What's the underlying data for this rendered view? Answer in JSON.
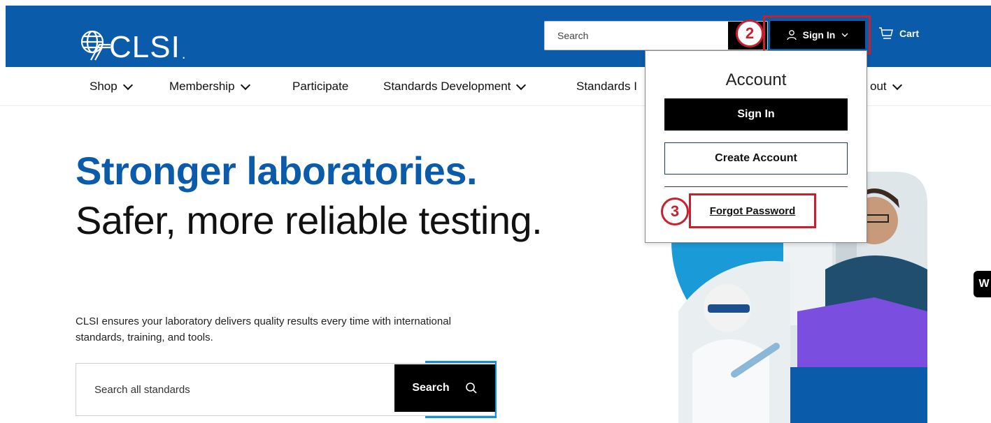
{
  "header": {
    "logo_text": "CLSI",
    "logo_suffix": ".",
    "search_placeholder": "Search",
    "signin_label": "Sign In",
    "cart_label": "Cart"
  },
  "steps": {
    "step2": "2",
    "step3": "3"
  },
  "nav": {
    "items": [
      {
        "label": "Shop"
      },
      {
        "label": "Membership"
      },
      {
        "label": "Participate"
      },
      {
        "label": "Standards Development"
      },
      {
        "label": "Standards I"
      },
      {
        "label": "out"
      }
    ]
  },
  "account_dropdown": {
    "title": "Account",
    "signin_label": "Sign In",
    "create_label": "Create Account",
    "forgot_label": "Forgot Password"
  },
  "hero": {
    "headline": "Stronger laboratories.",
    "subheadline": "Safer, more reliable testing.",
    "description": "CLSI ensures your laboratory delivers quality results every time with international standards, training, and tools.",
    "search_placeholder": "Search all standards",
    "search_button": "Search"
  },
  "side_chip": "W",
  "colors": {
    "brand_blue": "#0b5bab",
    "accent_blue": "#1492d4",
    "highlight_red": "#c8202f",
    "black": "#000000"
  }
}
